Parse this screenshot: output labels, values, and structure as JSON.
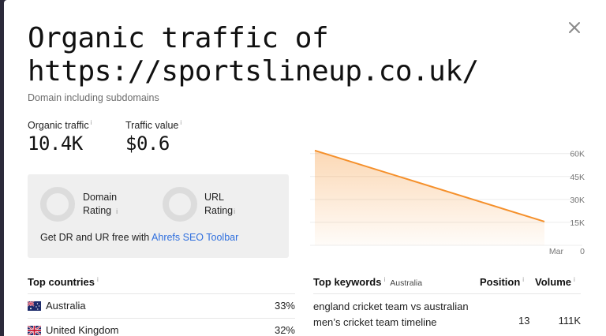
{
  "title_line1": "Organic traffic of",
  "title_line2": "https://sportslineup.co.uk/",
  "subtitle": "Domain including subdomains",
  "metrics": [
    {
      "label": "Organic traffic",
      "info": "i",
      "value": "10.4K"
    },
    {
      "label": "Traffic value",
      "info": "i",
      "value": "$0.6"
    }
  ],
  "ratings": {
    "dr_line1": "Domain",
    "dr_line2": "Rating",
    "ur_line1": "URL",
    "ur_line2": "Rating",
    "info": "i",
    "promo_text": "Get DR and UR free with ",
    "promo_link": "Ahrefs SEO Toolbar"
  },
  "chart_data": {
    "type": "area",
    "x": [
      "",
      "Mar"
    ],
    "series": [
      {
        "values": [
          62000,
          15500
        ]
      }
    ],
    "y_ticks": [
      "60K",
      "45K",
      "30K",
      "15K",
      "0"
    ],
    "x_tick": "Mar",
    "ylim": [
      0,
      65000
    ],
    "grid": true,
    "color": "#f5902b"
  },
  "countries": {
    "heading": "Top countries",
    "info": "i",
    "rows": [
      {
        "name": "Australia",
        "pct": "33%",
        "flag": "australia-flag"
      },
      {
        "name": "United Kingdom",
        "pct": "32%",
        "flag": "uk-flag"
      }
    ]
  },
  "keywords": {
    "heading": "Top keywords",
    "info": "i",
    "country_tag": "Australia",
    "col_position": "Position",
    "col_volume": "Volume",
    "rows": [
      {
        "keyword": "england cricket team vs australian men’s cricket team timeline",
        "position": "13",
        "volume": "111K"
      }
    ]
  }
}
